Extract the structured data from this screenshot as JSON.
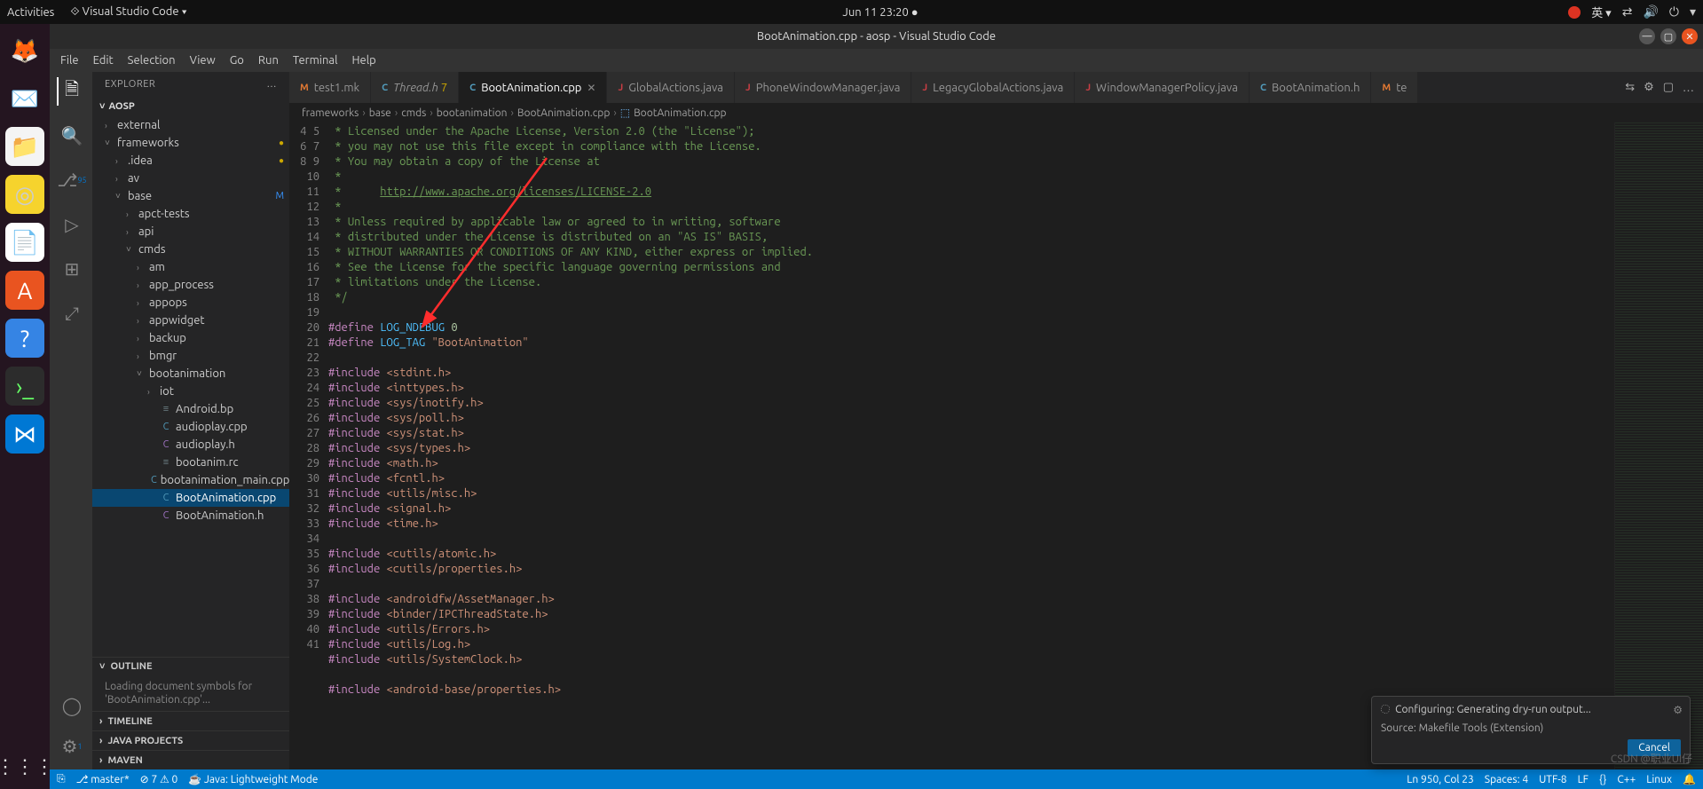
{
  "ubuntu": {
    "activities": "Activities",
    "app_menu": "Visual Studio Code ▾",
    "clock": "Jun 11  23:20",
    "lang": "英 ▾"
  },
  "window": {
    "title": "BootAnimation.cpp - aosp - Visual Studio Code"
  },
  "menubar": [
    "File",
    "Edit",
    "Selection",
    "View",
    "Go",
    "Run",
    "Terminal",
    "Help"
  ],
  "sidebar": {
    "title": "EXPLORER",
    "project": "AOSP",
    "nodes": [
      {
        "type": "folder",
        "depth": 0,
        "label": "external",
        "open": false
      },
      {
        "type": "folder",
        "depth": 0,
        "label": "frameworks",
        "open": true,
        "status": "dot"
      },
      {
        "type": "folder",
        "depth": 1,
        "label": ".idea",
        "open": false,
        "status": "dot"
      },
      {
        "type": "folder",
        "depth": 1,
        "label": "av",
        "open": false
      },
      {
        "type": "folder",
        "depth": 1,
        "label": "base",
        "open": true,
        "badge": "M"
      },
      {
        "type": "folder",
        "depth": 2,
        "label": "apct-tests",
        "open": false
      },
      {
        "type": "folder",
        "depth": 2,
        "label": "api",
        "open": false
      },
      {
        "type": "folder",
        "depth": 2,
        "label": "cmds",
        "open": true
      },
      {
        "type": "folder",
        "depth": 3,
        "label": "am",
        "open": false
      },
      {
        "type": "folder",
        "depth": 3,
        "label": "app_process",
        "open": false
      },
      {
        "type": "folder",
        "depth": 3,
        "label": "appops",
        "open": false
      },
      {
        "type": "folder",
        "depth": 3,
        "label": "appwidget",
        "open": false
      },
      {
        "type": "folder",
        "depth": 3,
        "label": "backup",
        "open": false
      },
      {
        "type": "folder",
        "depth": 3,
        "label": "bmgr",
        "open": false
      },
      {
        "type": "folder",
        "depth": 3,
        "label": "bootanimation",
        "open": true
      },
      {
        "type": "folder",
        "depth": 4,
        "label": "iot",
        "open": false
      },
      {
        "type": "file",
        "depth": 4,
        "label": "Android.bp",
        "icon": "b"
      },
      {
        "type": "file",
        "depth": 4,
        "label": "audioplay.cpp",
        "icon": "c"
      },
      {
        "type": "file",
        "depth": 4,
        "label": "audioplay.h",
        "icon": "h"
      },
      {
        "type": "file",
        "depth": 4,
        "label": "bootanim.rc",
        "icon": "b"
      },
      {
        "type": "file",
        "depth": 4,
        "label": "bootanimation_main.cpp",
        "icon": "c"
      },
      {
        "type": "file",
        "depth": 4,
        "label": "BootAnimation.cpp",
        "icon": "c",
        "selected": true
      },
      {
        "type": "file",
        "depth": 4,
        "label": "BootAnimation.h",
        "icon": "h"
      }
    ],
    "outline_label": "OUTLINE",
    "outline_msg": "Loading document symbols for 'BootAnimation.cpp'...",
    "timeline": "TIMELINE",
    "java_projects": "JAVA PROJECTS",
    "maven": "MAVEN"
  },
  "tabs": [
    {
      "lang": "M",
      "langcls": "lang-M",
      "label": "test1.mk"
    },
    {
      "lang": "C",
      "langcls": "lang-C",
      "label": "Thread.h",
      "italic": true,
      "suffix": "7",
      "suffixcolor": "#cca700"
    },
    {
      "lang": "C",
      "langcls": "lang-C",
      "label": "BootAnimation.cpp",
      "active": true,
      "close": true
    },
    {
      "lang": "J",
      "langcls": "lang-J",
      "label": "GlobalActions.java"
    },
    {
      "lang": "J",
      "langcls": "lang-J",
      "label": "PhoneWindowManager.java"
    },
    {
      "lang": "J",
      "langcls": "lang-J",
      "label": "LegacyGlobalActions.java"
    },
    {
      "lang": "J",
      "langcls": "lang-J",
      "label": "WindowManagerPolicy.java"
    },
    {
      "lang": "C",
      "langcls": "lang-C",
      "label": "BootAnimation.h"
    },
    {
      "lang": "M",
      "langcls": "lang-M",
      "label": "te",
      "overflow": true
    }
  ],
  "breadcrumb": [
    "frameworks",
    "base",
    "cmds",
    "bootanimation",
    "BootAnimation.cpp"
  ],
  "code": {
    "start": 4,
    "lines": [
      {
        "c": "comment",
        "t": " * Licensed under the Apache License, Version 2.0 (the \"License\");"
      },
      {
        "c": "comment",
        "t": " * you may not use this file except in compliance with the License."
      },
      {
        "c": "comment",
        "t": " * You may obtain a copy of the License at"
      },
      {
        "c": "comment",
        "t": " *"
      },
      {
        "c": "link",
        "t": " *      http://www.apache.org/licenses/LICENSE-2.0"
      },
      {
        "c": "comment",
        "t": " *"
      },
      {
        "c": "comment",
        "t": " * Unless required by applicable law or agreed to in writing, software"
      },
      {
        "c": "comment",
        "t": " * distributed under the License is distributed on an \"AS IS\" BASIS,"
      },
      {
        "c": "comment",
        "t": " * WITHOUT WARRANTIES OR CONDITIONS OF ANY KIND, either express or implied."
      },
      {
        "c": "comment",
        "t": " * See the License for the specific language governing permissions and"
      },
      {
        "c": "comment",
        "t": " * limitations under the License."
      },
      {
        "c": "comment",
        "t": " */"
      },
      {
        "c": "blank",
        "t": ""
      },
      {
        "c": "def",
        "pre": "#define",
        "mac": "LOG_NDEBUG",
        "val": "0",
        "valcls": "num"
      },
      {
        "c": "def",
        "pre": "#define",
        "mac": "LOG_TAG",
        "val": "\"BootAnimation\"",
        "valcls": "str"
      },
      {
        "c": "blank",
        "t": ""
      },
      {
        "c": "inc",
        "pre": "#include",
        "path": "<stdint.h>"
      },
      {
        "c": "inc",
        "pre": "#include",
        "path": "<inttypes.h>"
      },
      {
        "c": "inc",
        "pre": "#include",
        "path": "<sys/inotify.h>"
      },
      {
        "c": "inc",
        "pre": "#include",
        "path": "<sys/poll.h>"
      },
      {
        "c": "inc",
        "pre": "#include",
        "path": "<sys/stat.h>"
      },
      {
        "c": "inc",
        "pre": "#include",
        "path": "<sys/types.h>"
      },
      {
        "c": "inc",
        "pre": "#include",
        "path": "<math.h>"
      },
      {
        "c": "inc",
        "pre": "#include",
        "path": "<fcntl.h>"
      },
      {
        "c": "inc",
        "pre": "#include",
        "path": "<utils/misc.h>"
      },
      {
        "c": "inc",
        "pre": "#include",
        "path": "<signal.h>"
      },
      {
        "c": "inc",
        "pre": "#include",
        "path": "<time.h>"
      },
      {
        "c": "blank",
        "t": ""
      },
      {
        "c": "inc",
        "pre": "#include",
        "path": "<cutils/atomic.h>"
      },
      {
        "c": "inc",
        "pre": "#include",
        "path": "<cutils/properties.h>"
      },
      {
        "c": "blank",
        "t": ""
      },
      {
        "c": "inc",
        "pre": "#include",
        "path": "<androidfw/AssetManager.h>"
      },
      {
        "c": "inc",
        "pre": "#include",
        "path": "<binder/IPCThreadState.h>"
      },
      {
        "c": "inc",
        "pre": "#include",
        "path": "<utils/Errors.h>"
      },
      {
        "c": "inc",
        "pre": "#include",
        "path": "<utils/Log.h>"
      },
      {
        "c": "inc",
        "pre": "#include",
        "path": "<utils/SystemClock.h>"
      },
      {
        "c": "blank",
        "t": ""
      },
      {
        "c": "inc",
        "pre": "#include",
        "path": "<android-base/properties.h>"
      }
    ]
  },
  "notification": {
    "line1": "Configuring: Generating dry-run output...",
    "line2": "Source: Makefile Tools (Extension)",
    "cancel": "Cancel"
  },
  "status": {
    "branch": "master*",
    "errors": "⊘ 7 ⚠ 0",
    "java": "Java: Lightweight Mode",
    "pos": "Ln 950, Col 23",
    "spaces": "Spaces: 4",
    "enc": "UTF-8",
    "eol": "LF",
    "bracket": "{}",
    "lang": "C++",
    "linux": "Linux",
    "bell": "🔔"
  },
  "watermark": "CSDN @职业UI仔"
}
